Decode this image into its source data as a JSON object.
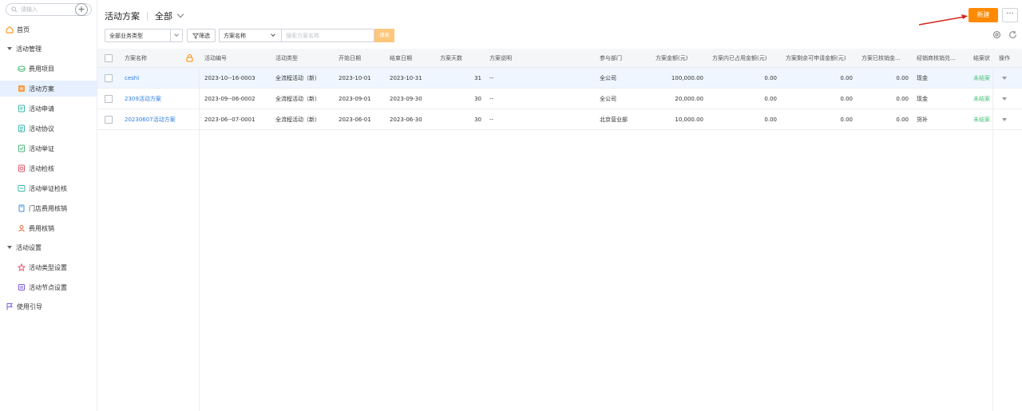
{
  "sidebar": {
    "search_placeholder": "请输入",
    "add_label": "+",
    "home": "首页",
    "group_activity": "活动管理",
    "items": [
      {
        "label": "费用项目",
        "icon": "coins-icon"
      },
      {
        "label": "活动方案",
        "icon": "plan-icon",
        "active": true
      },
      {
        "label": "活动申请",
        "icon": "application-icon"
      },
      {
        "label": "活动协议",
        "icon": "agreement-icon"
      },
      {
        "label": "活动举证",
        "icon": "evidence-icon"
      },
      {
        "label": "活动检核",
        "icon": "inspection-icon"
      },
      {
        "label": "活动举证检核",
        "icon": "evidence-check-icon"
      },
      {
        "label": "门店费用核销",
        "icon": "store-icon"
      },
      {
        "label": "费用核销",
        "icon": "writeoff-icon"
      }
    ],
    "group_settings": "活动设置",
    "settings_items": [
      {
        "label": "活动类型设置",
        "icon": "type-settings-icon"
      },
      {
        "label": "活动节点设置",
        "icon": "node-settings-icon"
      }
    ],
    "guide": "使用引导"
  },
  "header": {
    "title": "活动方案",
    "view": "全部",
    "new_button": "新建",
    "more_button": "···",
    "accent": "#ff8a00"
  },
  "filters": {
    "business_type": "全部业务类型",
    "filter_button": "筛选",
    "field_select": "方案名称",
    "search_placeholder": "搜索方案名称",
    "search_button": "搜索"
  },
  "table": {
    "columns": {
      "name": "方案名称",
      "code": "活动编号",
      "type": "活动类型",
      "start": "开始日期",
      "end": "结束日期",
      "days": "方案天数",
      "desc": "方案说明",
      "dept": "参与部门",
      "amount": "方案金额(元)",
      "used": "方案内已占用金额(元)",
      "remain": "方案剩余可申请金额(元)",
      "writtenoff": "方案已核销金...",
      "method": "经销商核销兑...",
      "status": "结案状",
      "op": "操作"
    },
    "rows": [
      {
        "name": "ceshi",
        "code": "2023-10--16-0003",
        "type": "全流程活动（新）",
        "start": "2023-10-01",
        "end": "2023-10-31",
        "days": "31",
        "desc": "--",
        "dept": "全公司",
        "amount": "100,000.00",
        "used": "0.00",
        "remain": "0.00",
        "writtenoff": "0.00",
        "method": "现金",
        "status": "未结案"
      },
      {
        "name": "2309活动方案",
        "code": "2023-09--06-0002",
        "type": "全流程活动（新）",
        "start": "2023-09-01",
        "end": "2023-09-30",
        "days": "30",
        "desc": "--",
        "dept": "全公司",
        "amount": "20,000.00",
        "used": "0.00",
        "remain": "0.00",
        "writtenoff": "0.00",
        "method": "现金",
        "status": "未结案"
      },
      {
        "name": "20230607活动方案",
        "code": "2023-06--07-0001",
        "type": "全流程活动（新）",
        "start": "2023-06-01",
        "end": "2023-06-30",
        "days": "30",
        "desc": "--",
        "dept": "北京营业部",
        "amount": "10,000.00",
        "used": "0.00",
        "remain": "0.00",
        "writtenoff": "0.00",
        "method": "货补",
        "status": "未结案"
      }
    ]
  }
}
